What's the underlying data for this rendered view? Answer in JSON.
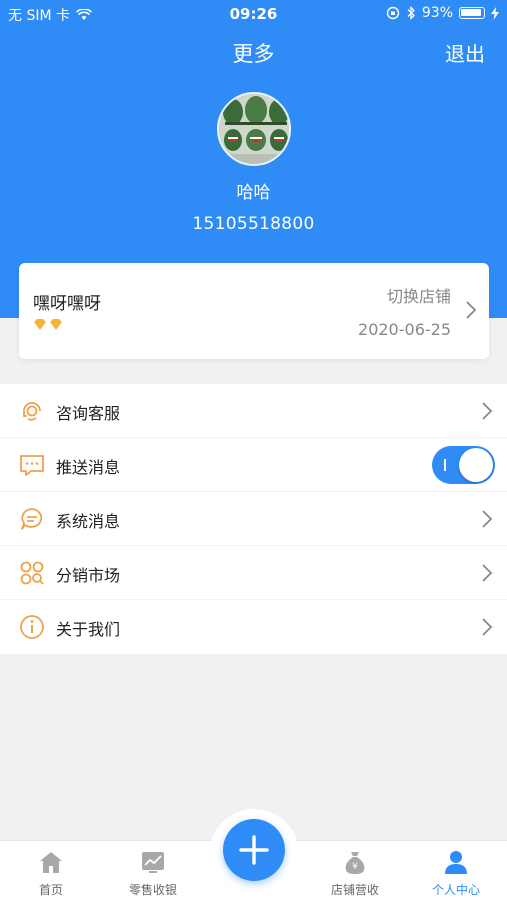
{
  "status_bar": {
    "carrier": "无 SIM 卡",
    "time": "09:26",
    "battery": "93%"
  },
  "nav": {
    "title": "更多",
    "logout": "退出"
  },
  "profile": {
    "name": "哈哈",
    "phone": "15105518800"
  },
  "store": {
    "name": "嘿呀嘿呀",
    "switch_label": "切换店铺",
    "date": "2020-06-25"
  },
  "menu": {
    "items": [
      {
        "label": "咨询客服",
        "icon": "customer-service-icon"
      },
      {
        "label": "推送消息",
        "icon": "message-icon",
        "toggle": true
      },
      {
        "label": "系统消息",
        "icon": "chat-bubble-icon"
      },
      {
        "label": "分销市场",
        "icon": "market-icon"
      },
      {
        "label": "关于我们",
        "icon": "info-icon"
      }
    ]
  },
  "tabbar": {
    "items": [
      {
        "label": "首页",
        "icon": "home-icon"
      },
      {
        "label": "零售收银",
        "icon": "chart-icon"
      },
      {
        "label": "店铺营收",
        "icon": "money-bag-icon"
      },
      {
        "label": "个人中心",
        "icon": "person-icon",
        "active": true
      }
    ]
  },
  "colors": {
    "primary": "#2f8bf5",
    "icon_orange": "#f0a24a",
    "heart_gold": "#f5b53a"
  }
}
